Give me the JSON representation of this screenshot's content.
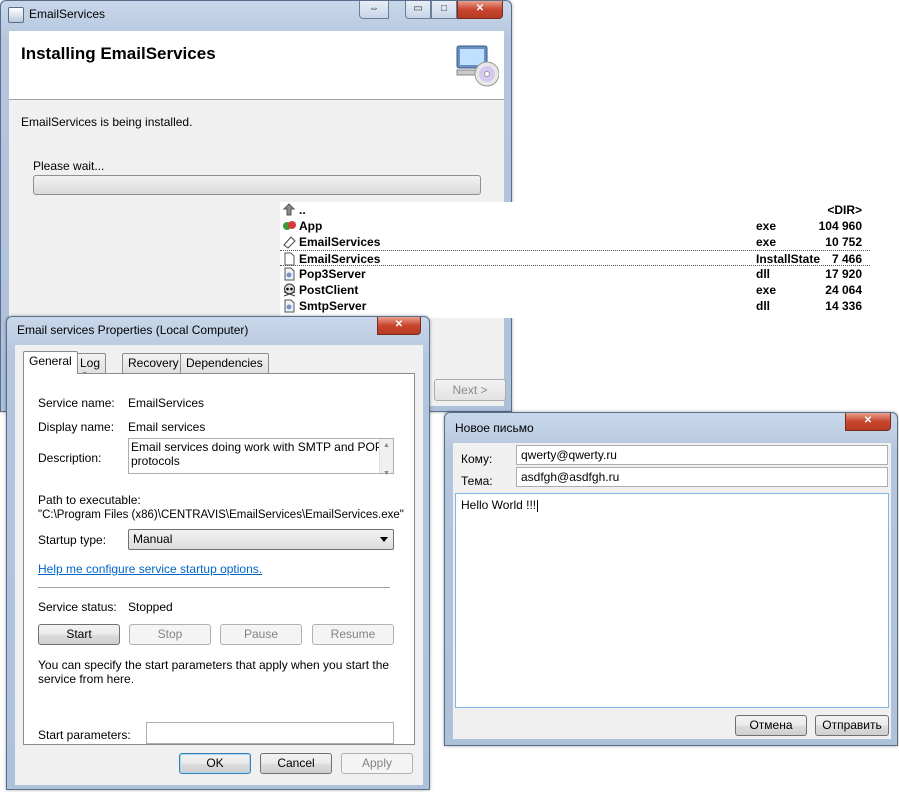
{
  "installer": {
    "title": "EmailServices",
    "header_title": "Installing EmailServices",
    "message": "EmailServices is being installed.",
    "wait_text": "Please wait...",
    "progress": 0,
    "next_label": "Next >",
    "caption_buttons": {
      "restore": "⇔",
      "minimize": "▭",
      "maximize": "□",
      "close": "✕"
    }
  },
  "file_list": {
    "rows": [
      {
        "icon": "up-folder-icon",
        "name": "..",
        "ext": "",
        "size": "<DIR>"
      },
      {
        "icon": "app-exe-icon",
        "name": "App",
        "ext": "exe",
        "size": "104 960"
      },
      {
        "icon": "installer-exe-icon",
        "name": "EmailServices",
        "ext": "exe",
        "size": "10 752"
      },
      {
        "icon": "document-icon",
        "name": "EmailServices",
        "ext": "InstallState",
        "size": "7 466"
      },
      {
        "icon": "dll-icon",
        "name": "Pop3Server",
        "ext": "dll",
        "size": "17 920"
      },
      {
        "icon": "skull-exe-icon",
        "name": "PostClient",
        "ext": "exe",
        "size": "24 064"
      },
      {
        "icon": "dll-icon",
        "name": "SmtpServer",
        "ext": "dll",
        "size": "14 336"
      }
    ]
  },
  "props": {
    "title": "Email services Properties (Local Computer)",
    "tabs": [
      "General",
      "Log On",
      "Recovery",
      "Dependencies"
    ],
    "service_name_label": "Service name:",
    "service_name": "EmailServices",
    "display_name_label": "Display name:",
    "display_name": "Email services",
    "description_label": "Description:",
    "description": "Email services doing work with SMTP and POP protocols",
    "path_label": "Path to executable:",
    "path": "\"C:\\Program Files (x86)\\CENTRAVIS\\EmailServices\\EmailServices.exe\"",
    "startup_type_label": "Startup type:",
    "startup_type": "Manual",
    "help_link": "Help me configure service startup options.",
    "status_label": "Service status:",
    "status": "Stopped",
    "start_label": "Start",
    "stop_label": "Stop",
    "pause_label": "Pause",
    "resume_label": "Resume",
    "hint": "You can specify the start parameters that apply when you start the service from here.",
    "params_label": "Start parameters:",
    "params_value": "",
    "ok_label": "OK",
    "cancel_label": "Cancel",
    "apply_label": "Apply"
  },
  "mail": {
    "title": "Новое письмо",
    "to_label": "Кому:",
    "to_value": "qwerty@qwerty.ru",
    "subject_label": "Тема:",
    "subject_value": "asdfgh@asdfgh.ru",
    "body": "Hello World !!!",
    "cancel_label": "Отмена",
    "send_label": "Отправить"
  }
}
